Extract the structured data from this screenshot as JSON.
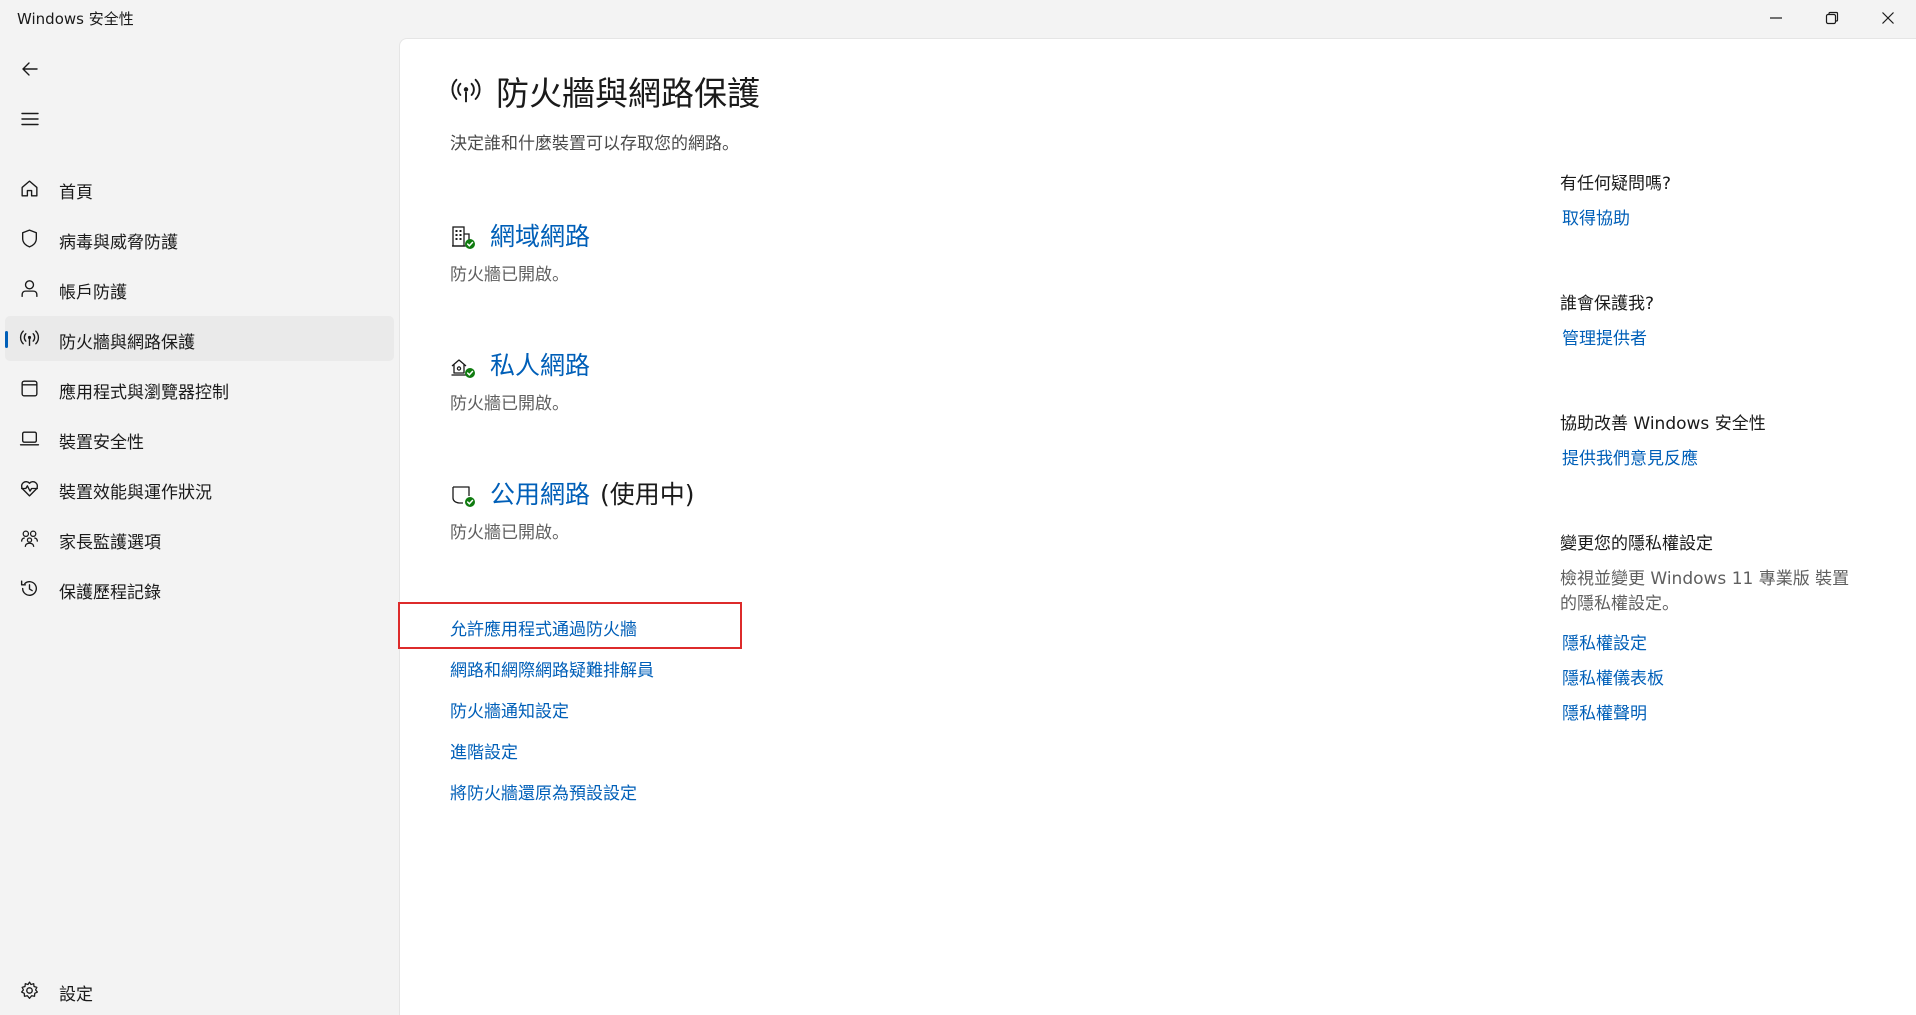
{
  "window": {
    "title": "Windows 安全性",
    "minimize_icon": "minimize-icon",
    "restore_icon": "restore-icon",
    "close_icon": "close-icon"
  },
  "sidebar": {
    "back_icon": "back-arrow-icon",
    "menu_icon": "hamburger-menu-icon",
    "items": [
      {
        "label": "首頁",
        "icon": "home-icon",
        "active": false
      },
      {
        "label": "病毒與威脅防護",
        "icon": "shield-icon",
        "active": false
      },
      {
        "label": "帳戶防護",
        "icon": "person-icon",
        "active": false
      },
      {
        "label": "防火牆與網路保護",
        "icon": "antenna-icon",
        "active": true
      },
      {
        "label": "應用程式與瀏覽器控制",
        "icon": "app-window-icon",
        "active": false
      },
      {
        "label": "裝置安全性",
        "icon": "laptop-icon",
        "active": false
      },
      {
        "label": "裝置效能與運作狀況",
        "icon": "heart-pulse-icon",
        "active": false
      },
      {
        "label": "家長監護選項",
        "icon": "family-icon",
        "active": false
      },
      {
        "label": "保護歷程記錄",
        "icon": "history-icon",
        "active": false
      }
    ],
    "settings": {
      "label": "設定",
      "icon": "gear-icon"
    }
  },
  "main": {
    "title": "防火牆與網路保護",
    "title_icon": "antenna-icon",
    "subtitle": "決定誰和什麼裝置可以存取您的網路。",
    "networks": [
      {
        "name": "網域網路",
        "suffix": "",
        "status": "防火牆已開啟。",
        "icon": "domain-network-icon"
      },
      {
        "name": "私人網路",
        "suffix": "",
        "status": "防火牆已開啟。",
        "icon": "private-network-icon"
      },
      {
        "name": "公用網路",
        "suffix": "(使用中)",
        "status": "防火牆已開啟。",
        "icon": "public-network-icon"
      }
    ],
    "links": [
      "允許應用程式通過防火牆",
      "網路和網際網路疑難排解員",
      "防火牆通知設定",
      "進階設定",
      "將防火牆還原為預設設定"
    ]
  },
  "right_panel": {
    "help": {
      "heading": "有任何疑問嗎?",
      "link": "取得協助"
    },
    "provider": {
      "heading": "誰會保護我?",
      "link": "管理提供者"
    },
    "improve": {
      "heading": "協助改善 Windows 安全性",
      "link": "提供我們意見反應"
    },
    "privacy": {
      "heading": "變更您的隱私權設定",
      "text": "檢視並變更 Windows 11 專業版 裝置的隱私權設定。",
      "links": [
        "隱私權設定",
        "隱私權儀表板",
        "隱私權聲明"
      ]
    }
  },
  "colors": {
    "accent": "#005fb8",
    "highlight": "#dd2b2b",
    "status_green": "#0f7b0f"
  }
}
